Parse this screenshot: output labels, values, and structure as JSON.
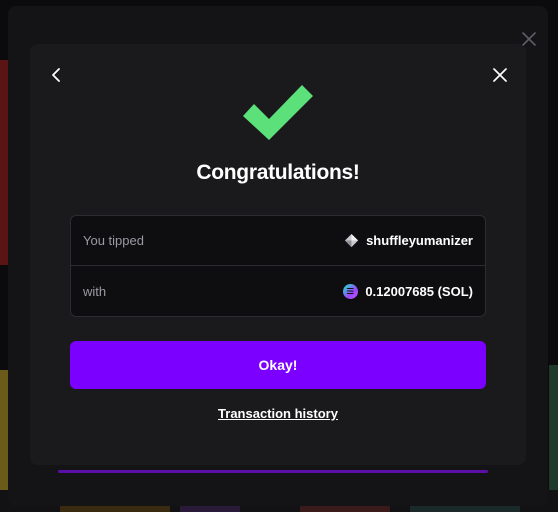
{
  "modal": {
    "title": "Congratulations!",
    "rows": [
      {
        "label": "You tipped",
        "value": "shuffleyumanizer",
        "icon": "ethereum-diamond-icon"
      },
      {
        "label": "with",
        "value": "0.12007685 (SOL)",
        "icon": "solana-icon"
      }
    ],
    "primary_button": "Okay!",
    "history_link": "Transaction history"
  },
  "icons": {
    "back": "chevron-left-icon",
    "close": "close-icon",
    "success": "checkmark-icon"
  },
  "colors": {
    "accent": "#7b00ff",
    "success": "#5ce07a",
    "modal_bg": "#1a1a1d"
  }
}
